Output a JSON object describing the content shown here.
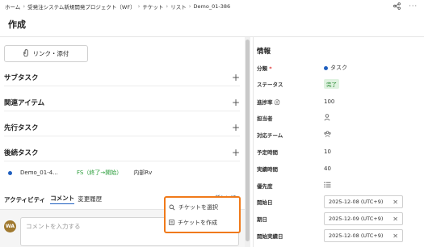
{
  "breadcrumb": {
    "home": "ホーム",
    "project": "受発注システム新規開発プロジェクト（WF）",
    "tickets": "チケット",
    "list": "リスト",
    "current": "Demo_01-386"
  },
  "header": {
    "title": "作成",
    "icons": [
      "share-icon",
      "more-icon"
    ]
  },
  "left": {
    "link_button": "リンク・添付",
    "sections": [
      {
        "label": "サブタスク"
      },
      {
        "label": "関連アイテム"
      },
      {
        "label": "先行タスク"
      },
      {
        "label": "後続タスク"
      }
    ],
    "ticket_row": {
      "id": "Demo_01-4...",
      "relation": "FS（終了→開始）",
      "type": "内部Rv"
    },
    "tabs": {
      "activity": "アクティビティ",
      "comment": "コメント",
      "history": "変更履歴"
    },
    "new_button": "+ 新しい順",
    "comment": {
      "avatar": "WA",
      "placeholder": "コメントを入力する"
    },
    "popup": {
      "select": "チケットを選択",
      "create": "チケットを作成"
    }
  },
  "right": {
    "title": "情報",
    "fields": {
      "category": {
        "label": "分類",
        "required": "*",
        "value": "タスク"
      },
      "status": {
        "label": "ステータス",
        "value": "完了"
      },
      "progress": {
        "label": "進捗率",
        "value": "100"
      },
      "assignee": {
        "label": "担当者"
      },
      "team": {
        "label": "対応チーム"
      },
      "planned_hours": {
        "label": "予定時間",
        "value": "10"
      },
      "actual_hours": {
        "label": "実績時間",
        "value": "40"
      },
      "priority": {
        "label": "優先度"
      },
      "start_date": {
        "label": "開始日",
        "value": "2025-12-08 (UTC+9)"
      },
      "due_date": {
        "label": "期日",
        "value": "2025-12-09 (UTC+9)"
      },
      "actual_start": {
        "label": "開始実績日",
        "value": "2025-12-08 (UTC+9)"
      }
    }
  },
  "colors": {
    "accent": "#1f5fbf",
    "status_green": "#2a8a34",
    "highlight_orange": "#f07a1a"
  }
}
